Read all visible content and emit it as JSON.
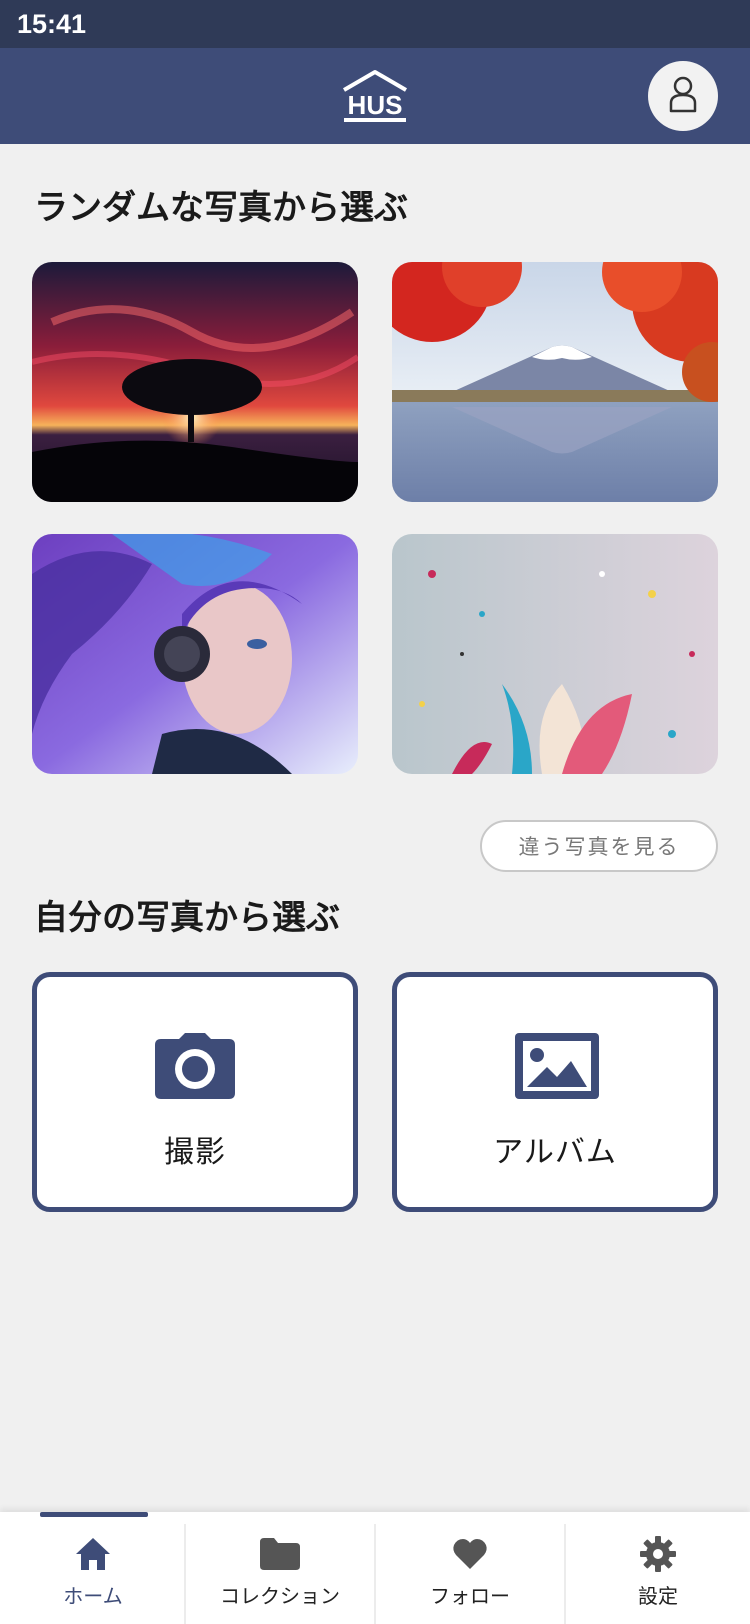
{
  "status_bar": {
    "time": "15:41"
  },
  "header": {
    "logo_text": "HUS",
    "logo_icon": "house-logo",
    "profile_icon": "user-icon"
  },
  "random_section": {
    "title": "ランダムな写真から選ぶ",
    "photos": [
      {
        "name": "sunset-tree"
      },
      {
        "name": "mount-fuji-autumn"
      },
      {
        "name": "headphone-girl-art"
      },
      {
        "name": "paint-splash-art"
      }
    ],
    "more_label": "違う写真を見る"
  },
  "own_section": {
    "title": "自分の写真から選ぶ",
    "camera_label": "撮影",
    "album_label": "アルバム",
    "accent": "#3e4c78"
  },
  "bottom_nav": {
    "items": [
      {
        "label": "ホーム",
        "icon": "home-icon",
        "active": true
      },
      {
        "label": "コレクション",
        "icon": "folder-icon",
        "active": false
      },
      {
        "label": "フォロー",
        "icon": "heart-icon",
        "active": false
      },
      {
        "label": "設定",
        "icon": "gear-icon",
        "active": false
      }
    ]
  },
  "colors": {
    "header": "#3e4c78",
    "status_bar": "#2f3a57",
    "background": "#f0f0f0"
  }
}
